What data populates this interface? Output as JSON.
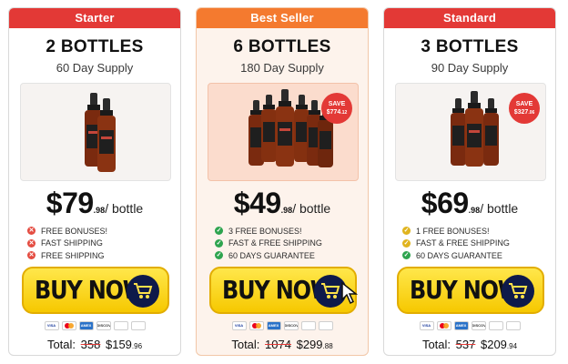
{
  "colors": {
    "red": "#e33936",
    "orange": "#f47a2f",
    "green": "#2ea44f",
    "yellow": "#f6c800",
    "navy": "#0e1a4a"
  },
  "buy_label": "BUY NOW",
  "total_prefix": "Total:",
  "payment_cards": [
    "VISA",
    "Mastercard",
    "AMEX",
    "DISCOVER",
    "icon",
    "icon"
  ],
  "cards": [
    {
      "header": "Starter",
      "header_color": "#e33936",
      "title": "2 BOTTLES",
      "supply": "60 Day Supply",
      "bottles": 2,
      "save_line1": "",
      "save_amount": "",
      "save_cents": "",
      "price": "$79",
      "cents": ".98",
      "unit": "/ bottle",
      "benefits": [
        "FREE BONUSES!",
        "FAST SHIPPING",
        "FREE SHIPPING"
      ],
      "benefit_icon": "x",
      "total_old": "358",
      "total_new": "$159",
      "total_cents": ".96"
    },
    {
      "header": "Best Seller",
      "header_color": "#f47a2f",
      "title": "6 BOTTLES",
      "supply": "180 Day Supply",
      "bottles": 6,
      "save_line1": "SAVE",
      "save_amount": "$774",
      "save_cents": ".12",
      "price": "$49",
      "cents": ".98",
      "unit": "/ bottle",
      "benefits": [
        "3 FREE BONUSES!",
        "FAST & FREE SHIPPING",
        "60 DAYS GUARANTEE"
      ],
      "benefit_icon": "check",
      "total_old": "1074",
      "total_new": "$299",
      "total_cents": ".88"
    },
    {
      "header": "Standard",
      "header_color": "#e33936",
      "title": "3 BOTTLES",
      "supply": "90 Day Supply",
      "bottles": 3,
      "save_line1": "SAVE",
      "save_amount": "$327",
      "save_cents": ".06",
      "price": "$69",
      "cents": ".98",
      "unit": "/ bottle",
      "benefits": [
        "1 FREE BONUSES!",
        "FAST & FREE SHIPPING",
        "60 DAYS GUARANTEE"
      ],
      "benefit_icon": "check",
      "total_old": "537",
      "total_new": "$209",
      "total_cents": ".94"
    }
  ]
}
